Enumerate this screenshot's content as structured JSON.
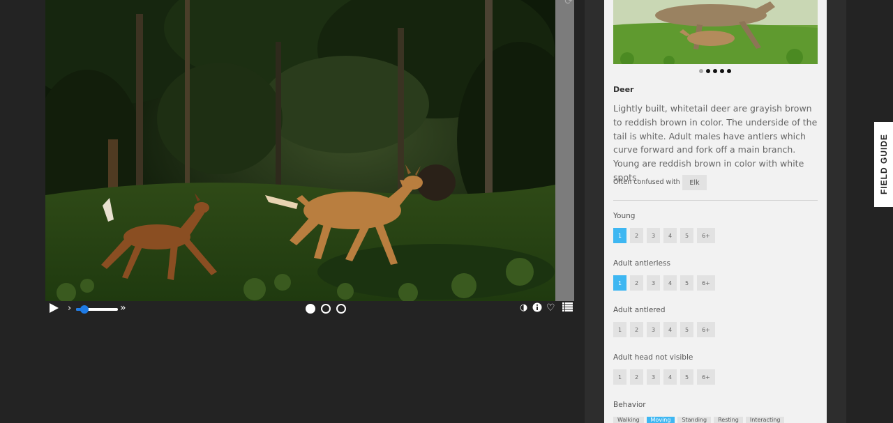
{
  "controls": {
    "play": "▶",
    "step_back": "›",
    "fast_forward": "»",
    "frames": 3,
    "current_frame": 1,
    "speed_level": 0.15
  },
  "guide": {
    "species_name": "Deer",
    "description": "Lightly built, whitetail deer are grayish brown to reddish brown in color. The underside of the tail is white. Adult males have antlers which curve forward and fork off a main branch. Young are reddish brown in color with white spots.",
    "confused_label": "Often confused with",
    "confused_with": "Elk",
    "photo_count": 5,
    "photo_active": 1,
    "questions": [
      {
        "label": "Young",
        "selected": "1"
      },
      {
        "label": "Adult antlerless",
        "selected": "1"
      },
      {
        "label": "Adult antlered",
        "selected": null
      },
      {
        "label": "Adult head not visible",
        "selected": null
      }
    ],
    "count_options": [
      "1",
      "2",
      "3",
      "4",
      "5",
      "6+"
    ],
    "behavior_label": "Behavior",
    "behavior_options": [
      "Walking",
      "Moving",
      "Standing",
      "Resting",
      "Interacting"
    ],
    "behavior_selected": "Moving"
  },
  "tab": {
    "field_guide": "FIELD GUIDE"
  },
  "colors": {
    "accent": "#3eb7f2",
    "slider": "#1e7be6"
  },
  "icons": [
    "play-icon",
    "step-back-icon",
    "fast-forward-icon",
    "contrast-icon",
    "info-icon",
    "heart-icon",
    "list-icon",
    "refresh-icon"
  ]
}
